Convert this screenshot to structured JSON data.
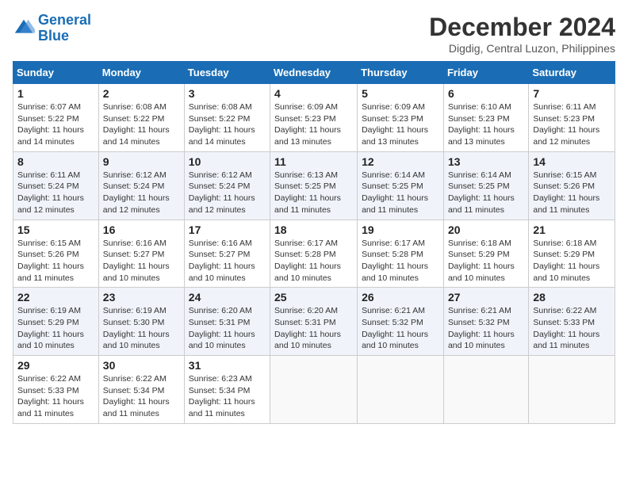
{
  "logo": {
    "text_general": "General",
    "text_blue": "Blue"
  },
  "title": "December 2024",
  "location": "Digdig, Central Luzon, Philippines",
  "days_of_week": [
    "Sunday",
    "Monday",
    "Tuesday",
    "Wednesday",
    "Thursday",
    "Friday",
    "Saturday"
  ],
  "weeks": [
    [
      {
        "day": "1",
        "sunrise": "6:07 AM",
        "sunset": "5:22 PM",
        "daylight": "11 hours and 14 minutes."
      },
      {
        "day": "2",
        "sunrise": "6:08 AM",
        "sunset": "5:22 PM",
        "daylight": "11 hours and 14 minutes."
      },
      {
        "day": "3",
        "sunrise": "6:08 AM",
        "sunset": "5:22 PM",
        "daylight": "11 hours and 14 minutes."
      },
      {
        "day": "4",
        "sunrise": "6:09 AM",
        "sunset": "5:23 PM",
        "daylight": "11 hours and 13 minutes."
      },
      {
        "day": "5",
        "sunrise": "6:09 AM",
        "sunset": "5:23 PM",
        "daylight": "11 hours and 13 minutes."
      },
      {
        "day": "6",
        "sunrise": "6:10 AM",
        "sunset": "5:23 PM",
        "daylight": "11 hours and 13 minutes."
      },
      {
        "day": "7",
        "sunrise": "6:11 AM",
        "sunset": "5:23 PM",
        "daylight": "11 hours and 12 minutes."
      }
    ],
    [
      {
        "day": "8",
        "sunrise": "6:11 AM",
        "sunset": "5:24 PM",
        "daylight": "11 hours and 12 minutes."
      },
      {
        "day": "9",
        "sunrise": "6:12 AM",
        "sunset": "5:24 PM",
        "daylight": "11 hours and 12 minutes."
      },
      {
        "day": "10",
        "sunrise": "6:12 AM",
        "sunset": "5:24 PM",
        "daylight": "11 hours and 12 minutes."
      },
      {
        "day": "11",
        "sunrise": "6:13 AM",
        "sunset": "5:25 PM",
        "daylight": "11 hours and 11 minutes."
      },
      {
        "day": "12",
        "sunrise": "6:14 AM",
        "sunset": "5:25 PM",
        "daylight": "11 hours and 11 minutes."
      },
      {
        "day": "13",
        "sunrise": "6:14 AM",
        "sunset": "5:25 PM",
        "daylight": "11 hours and 11 minutes."
      },
      {
        "day": "14",
        "sunrise": "6:15 AM",
        "sunset": "5:26 PM",
        "daylight": "11 hours and 11 minutes."
      }
    ],
    [
      {
        "day": "15",
        "sunrise": "6:15 AM",
        "sunset": "5:26 PM",
        "daylight": "11 hours and 11 minutes."
      },
      {
        "day": "16",
        "sunrise": "6:16 AM",
        "sunset": "5:27 PM",
        "daylight": "11 hours and 10 minutes."
      },
      {
        "day": "17",
        "sunrise": "6:16 AM",
        "sunset": "5:27 PM",
        "daylight": "11 hours and 10 minutes."
      },
      {
        "day": "18",
        "sunrise": "6:17 AM",
        "sunset": "5:28 PM",
        "daylight": "11 hours and 10 minutes."
      },
      {
        "day": "19",
        "sunrise": "6:17 AM",
        "sunset": "5:28 PM",
        "daylight": "11 hours and 10 minutes."
      },
      {
        "day": "20",
        "sunrise": "6:18 AM",
        "sunset": "5:29 PM",
        "daylight": "11 hours and 10 minutes."
      },
      {
        "day": "21",
        "sunrise": "6:18 AM",
        "sunset": "5:29 PM",
        "daylight": "11 hours and 10 minutes."
      }
    ],
    [
      {
        "day": "22",
        "sunrise": "6:19 AM",
        "sunset": "5:29 PM",
        "daylight": "11 hours and 10 minutes."
      },
      {
        "day": "23",
        "sunrise": "6:19 AM",
        "sunset": "5:30 PM",
        "daylight": "11 hours and 10 minutes."
      },
      {
        "day": "24",
        "sunrise": "6:20 AM",
        "sunset": "5:31 PM",
        "daylight": "11 hours and 10 minutes."
      },
      {
        "day": "25",
        "sunrise": "6:20 AM",
        "sunset": "5:31 PM",
        "daylight": "11 hours and 10 minutes."
      },
      {
        "day": "26",
        "sunrise": "6:21 AM",
        "sunset": "5:32 PM",
        "daylight": "11 hours and 10 minutes."
      },
      {
        "day": "27",
        "sunrise": "6:21 AM",
        "sunset": "5:32 PM",
        "daylight": "11 hours and 10 minutes."
      },
      {
        "day": "28",
        "sunrise": "6:22 AM",
        "sunset": "5:33 PM",
        "daylight": "11 hours and 11 minutes."
      }
    ],
    [
      {
        "day": "29",
        "sunrise": "6:22 AM",
        "sunset": "5:33 PM",
        "daylight": "11 hours and 11 minutes."
      },
      {
        "day": "30",
        "sunrise": "6:22 AM",
        "sunset": "5:34 PM",
        "daylight": "11 hours and 11 minutes."
      },
      {
        "day": "31",
        "sunrise": "6:23 AM",
        "sunset": "5:34 PM",
        "daylight": "11 hours and 11 minutes."
      },
      null,
      null,
      null,
      null
    ]
  ]
}
